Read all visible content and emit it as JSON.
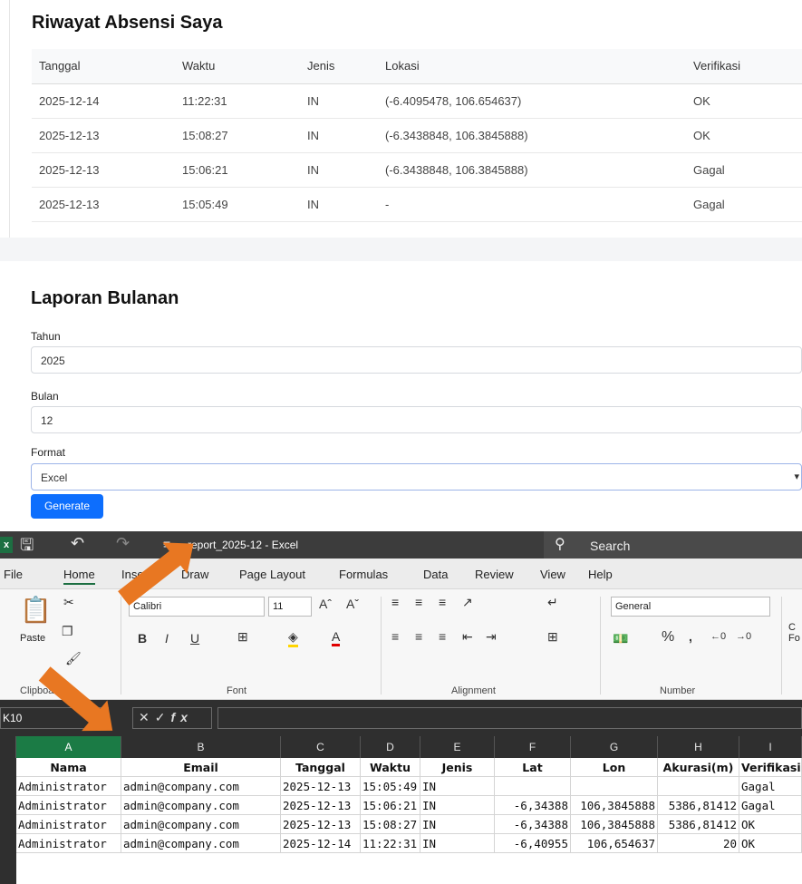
{
  "history": {
    "title": "Riwayat Absensi Saya",
    "columns": [
      "Tanggal",
      "Waktu",
      "Jenis",
      "Lokasi",
      "Verifikasi"
    ],
    "rows": [
      [
        "2025-12-14",
        "11:22:31",
        "IN",
        "(-6.4095478, 106.654637)",
        "OK"
      ],
      [
        "2025-12-13",
        "15:08:27",
        "IN",
        "(-6.3438848, 106.3845888)",
        "OK"
      ],
      [
        "2025-12-13",
        "15:06:21",
        "IN",
        "(-6.3438848, 106.3845888)",
        "Gagal"
      ],
      [
        "2025-12-13",
        "15:05:49",
        "IN",
        "-",
        "Gagal"
      ]
    ]
  },
  "report": {
    "title": "Laporan Bulanan",
    "year_label": "Tahun",
    "year_value": "2025",
    "month_label": "Bulan",
    "month_value": "12",
    "format_label": "Format",
    "format_value": "Excel",
    "generate_label": "Generate"
  },
  "excel": {
    "title": "report_2025-12  -  Excel",
    "search_label": "Search",
    "menu": [
      "File",
      "Home",
      "Insert",
      "Draw",
      "Page Layout",
      "Formulas",
      "Data",
      "Review",
      "View",
      "Help"
    ],
    "ribbon": {
      "paste": "Paste",
      "clipboard": "Clipboard",
      "font_name": "Calibri",
      "font_size": "11",
      "font_group": "Font",
      "alignment_group": "Alignment",
      "number_format": "General",
      "number_group": "Number",
      "cond_format": "C\nFo"
    },
    "name_box": "K10",
    "columns": [
      "A",
      "B",
      "C",
      "D",
      "E",
      "F",
      "G",
      "H",
      "I"
    ],
    "header_row": [
      "Nama",
      "Email",
      "Tanggal",
      "Waktu",
      "Jenis",
      "Lat",
      "Lon",
      "Akurasi(m)",
      "Verifikasi"
    ],
    "rows": [
      [
        "Administrator",
        "admin@company.com",
        "2025-12-13",
        "15:05:49",
        "IN",
        "",
        "",
        "",
        "Gagal"
      ],
      [
        "Administrator",
        "admin@company.com",
        "2025-12-13",
        "15:06:21",
        "IN",
        "-6,34388",
        "106,3845888",
        "5386,81412",
        "Gagal"
      ],
      [
        "Administrator",
        "admin@company.com",
        "2025-12-13",
        "15:08:27",
        "IN",
        "-6,34388",
        "106,3845888",
        "5386,81412",
        "OK"
      ],
      [
        "Administrator",
        "admin@company.com",
        "2025-12-14",
        "11:22:31",
        "IN",
        "-6,40955",
        "106,654637",
        "20",
        "OK"
      ]
    ],
    "accent_color": "#1d6f42",
    "annotation_color": "#e87722"
  }
}
